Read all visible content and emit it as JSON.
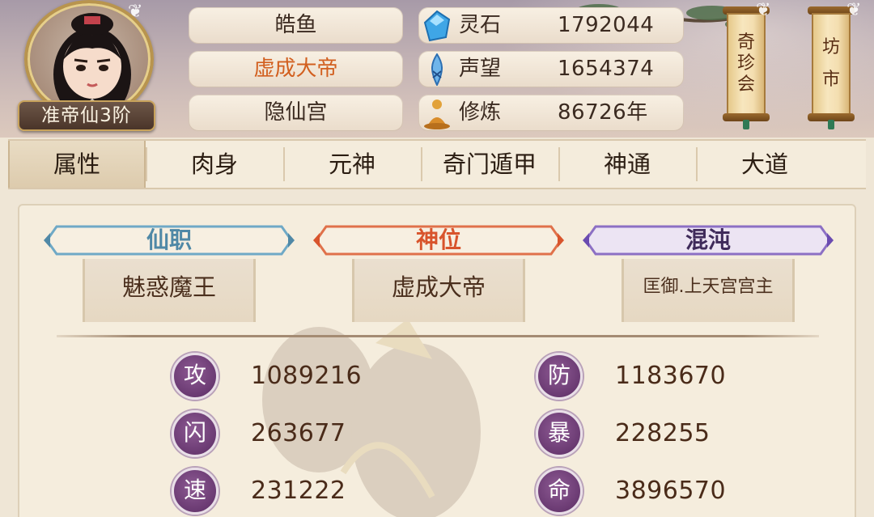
{
  "player": {
    "rank_badge": "准帝仙3阶",
    "name": "皓鱼",
    "title": "虚成大帝",
    "sect": "隐仙宫"
  },
  "resources": [
    {
      "icon": "spirit-stone-icon",
      "label": "灵石",
      "value": "1792044"
    },
    {
      "icon": "prestige-icon",
      "label": "声望",
      "value": "1654374"
    },
    {
      "icon": "cultivation-icon",
      "label": "修炼",
      "value": "86726年"
    }
  ],
  "side_buttons": {
    "treasure": [
      "奇",
      "珍",
      "会"
    ],
    "market": [
      "坊",
      "市"
    ]
  },
  "tabs": [
    "属性",
    "肉身",
    "元神",
    "奇门遁甲",
    "神通",
    "大道"
  ],
  "active_tab": "属性",
  "ranks": [
    {
      "heading": "仙职",
      "value": "魅惑魔王",
      "color": "#4f88a6"
    },
    {
      "heading": "神位",
      "value": "虚成大帝",
      "color": "#d8542c"
    },
    {
      "heading": "混沌",
      "value": "匡御.上天宫宫主",
      "color": "#5a3f8a"
    }
  ],
  "stats": [
    {
      "glyph": "攻",
      "value": "1089216"
    },
    {
      "glyph": "防",
      "value": "1183670"
    },
    {
      "glyph": "闪",
      "value": "263677"
    },
    {
      "glyph": "暴",
      "value": "228255"
    },
    {
      "glyph": "速",
      "value": "231222"
    },
    {
      "glyph": "命",
      "value": "3896570"
    }
  ]
}
